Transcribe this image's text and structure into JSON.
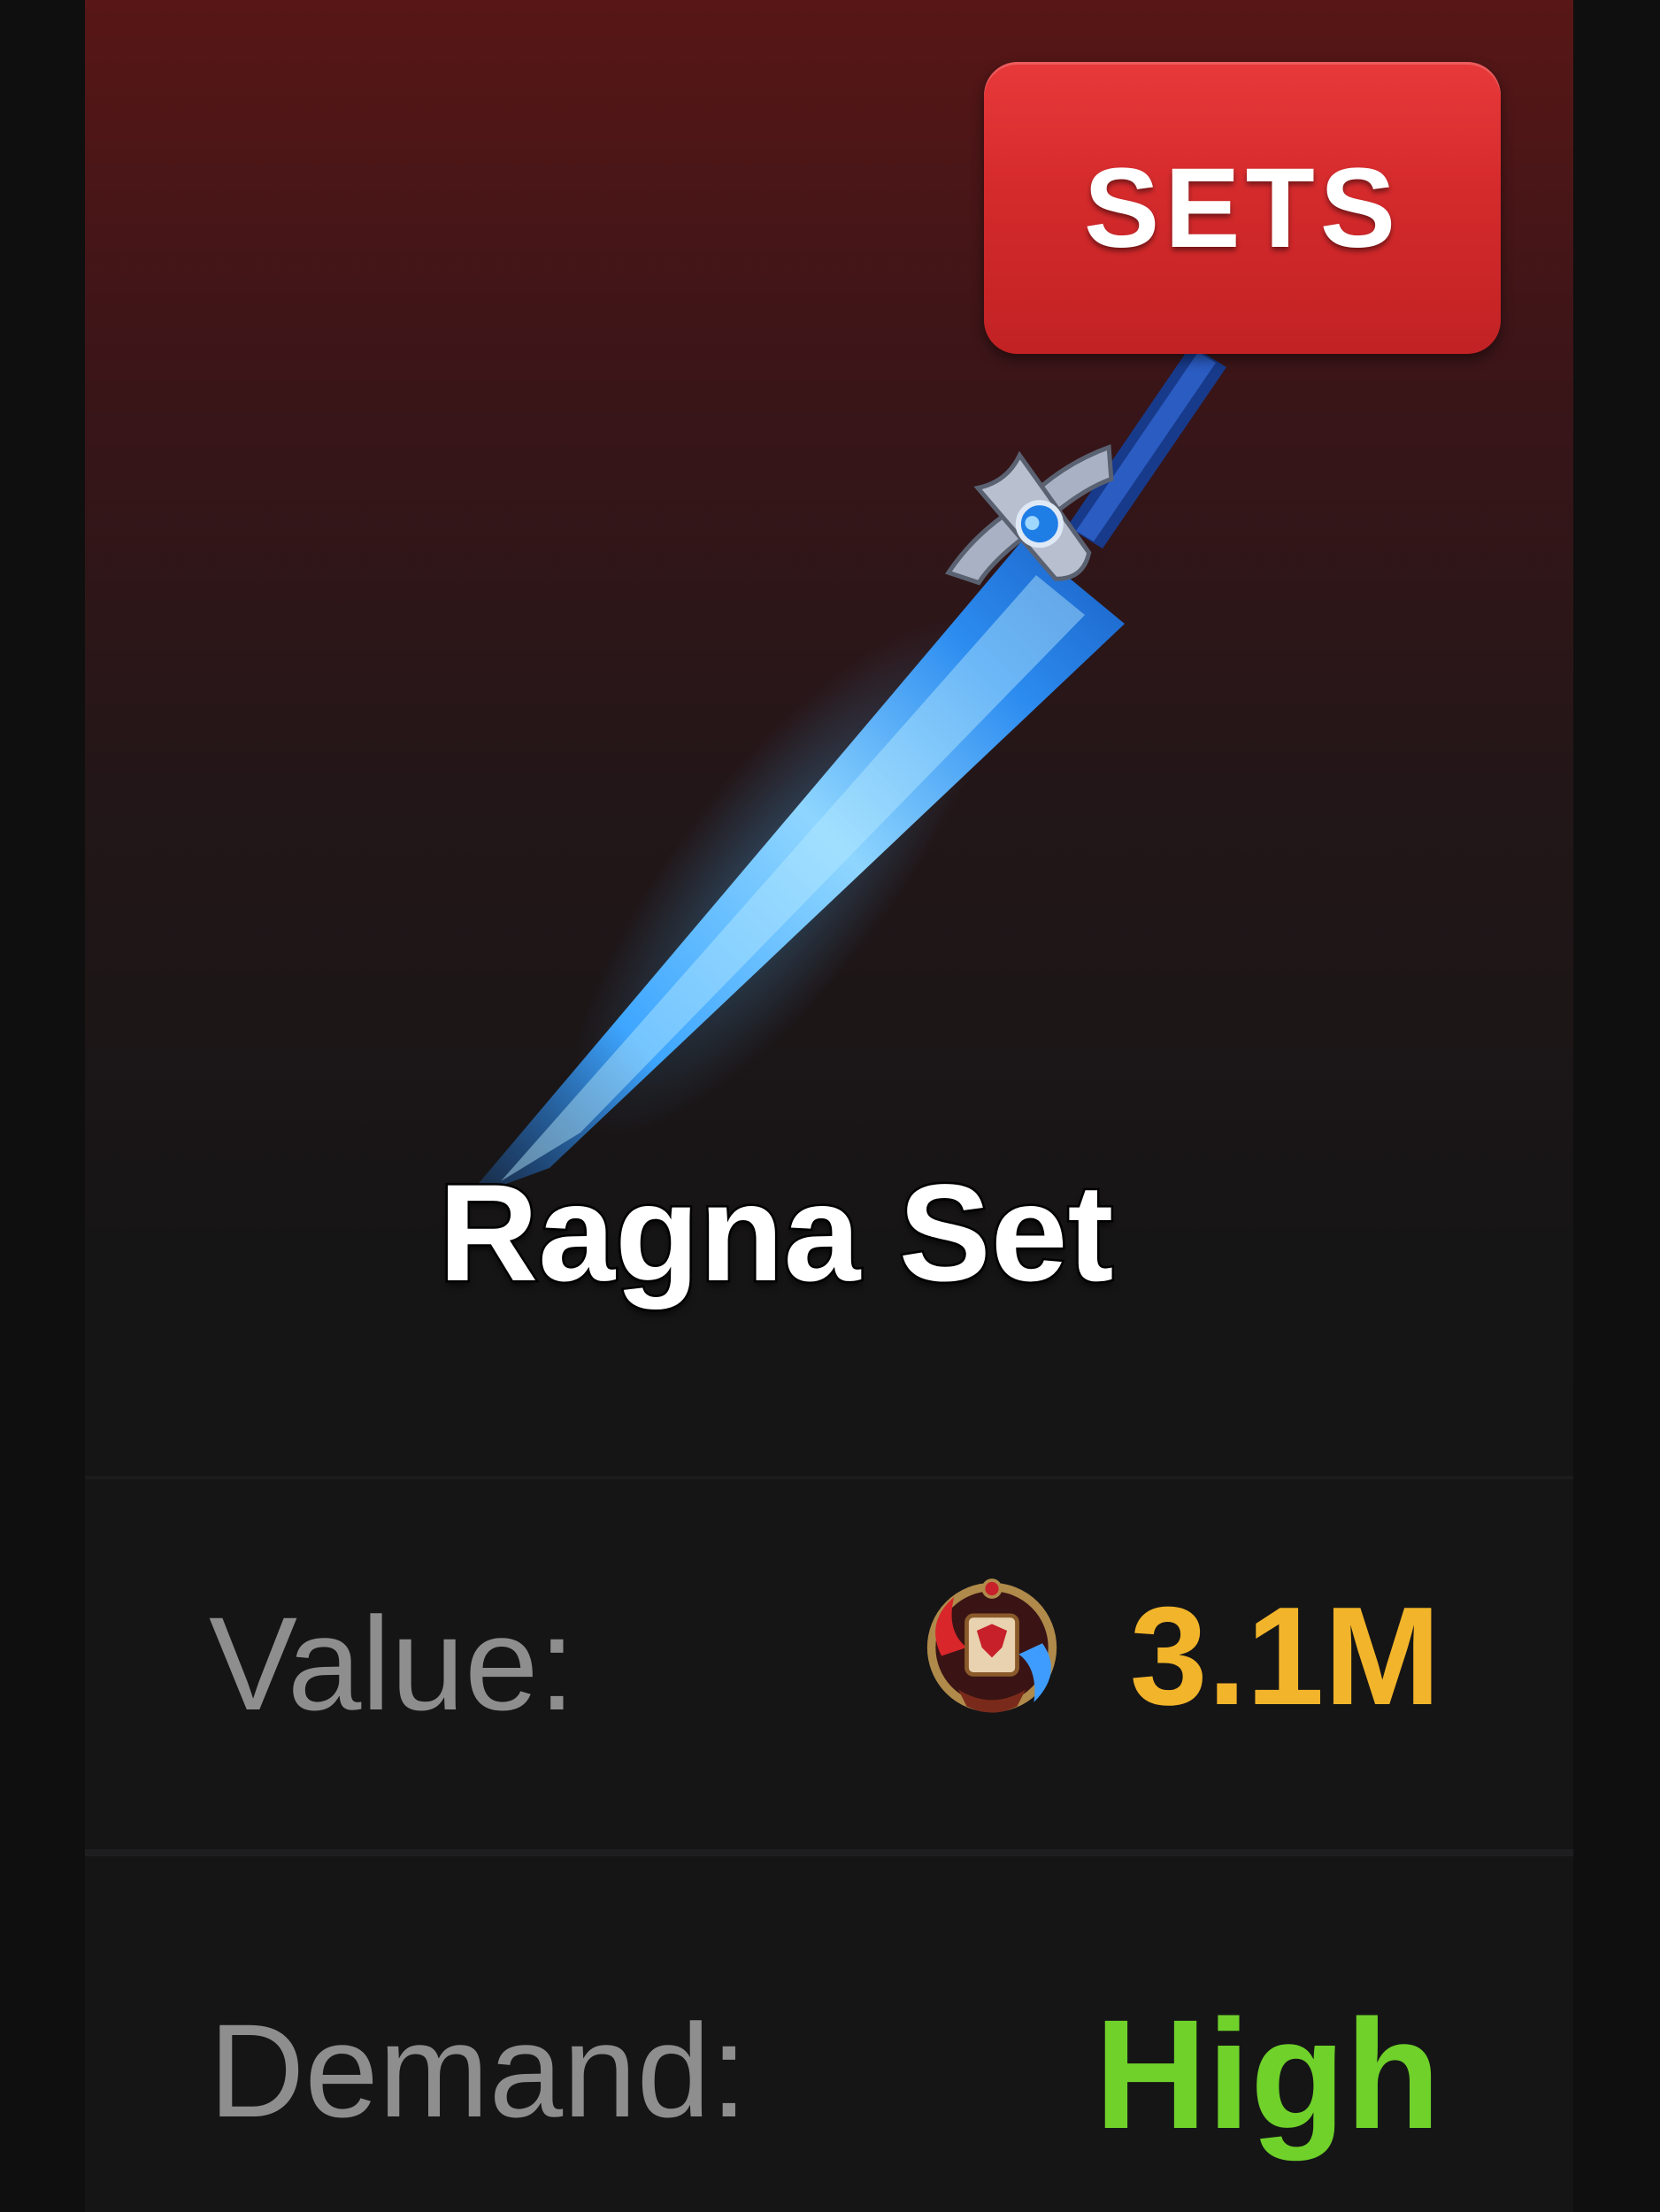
{
  "badge": {
    "label": "SETS"
  },
  "item": {
    "name": "Ragna Set"
  },
  "stats": {
    "value_label": "Value:",
    "value_amount": "3.1M",
    "value_currency_icon": "emblem-icon",
    "demand_label": "Demand:",
    "demand_value": "High"
  },
  "colors": {
    "badge_red": "#d42a2c",
    "value_gold": "#f2b42a",
    "demand_green": "#6fd12a",
    "label_gray": "#8e8e8e"
  }
}
